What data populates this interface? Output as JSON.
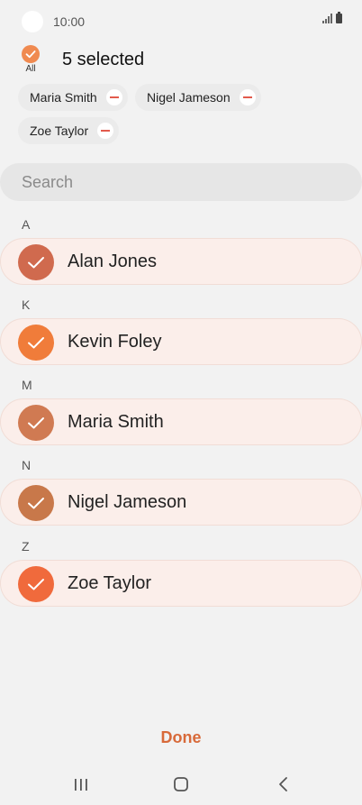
{
  "status_bar": {
    "time": "10:00"
  },
  "header": {
    "all_label": "All",
    "selected_text": "5 selected"
  },
  "chips": [
    {
      "label": "Maria Smith"
    },
    {
      "label": "Nigel Jameson"
    },
    {
      "label": "Zoe Taylor"
    }
  ],
  "search": {
    "placeholder": "Search"
  },
  "sections": [
    {
      "letter": "A",
      "contact": {
        "name": "Alan Jones",
        "check_color": "#d06a4e"
      }
    },
    {
      "letter": "K",
      "contact": {
        "name": "Kevin Foley",
        "check_color": "#f07c3a"
      }
    },
    {
      "letter": "M",
      "contact": {
        "name": "Maria Smith",
        "check_color": "#d07a52"
      }
    },
    {
      "letter": "N",
      "contact": {
        "name": "Nigel Jameson",
        "check_color": "#c8784a"
      }
    },
    {
      "letter": "Z",
      "contact": {
        "name": "Zoe Taylor",
        "check_color": "#f06a3c"
      }
    }
  ],
  "footer": {
    "done_label": "Done"
  },
  "colors": {
    "accent": "#d86a3a",
    "row_bg": "#fbeeea",
    "remove_red": "#e25a4c"
  }
}
